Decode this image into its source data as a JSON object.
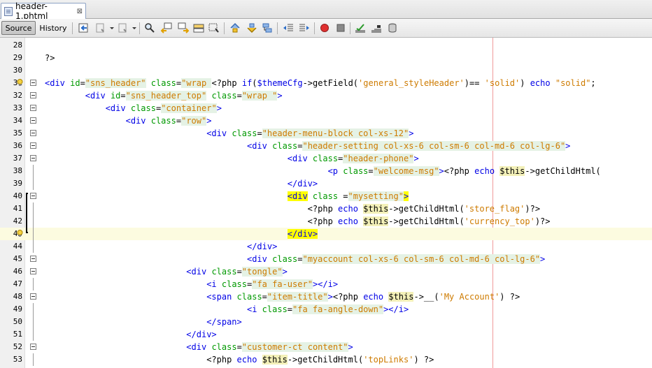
{
  "tab": {
    "title": "header-1.phtml",
    "close": "⊠"
  },
  "toolbar": {
    "source_label": "Source",
    "history_label": "History"
  },
  "editor": {
    "lines": [
      {
        "n": "28",
        "html": ""
      },
      {
        "n": "29",
        "html": "?>"
      },
      {
        "n": "30",
        "html": ""
      },
      {
        "n": "31",
        "html": "<span class=tag>&lt;div</span> <span class=attr>id</span>=<span class=strbg>\"sns_header\"</span> <span class=attr>class</span>=<span class=strbg>\"wrap </span><span>&lt;?php</span> <span class=kw>if</span>(<span class=kw>$themeCfg</span>-&gt;getField(<span class=phpstr>'general_styleHeader'</span>)== <span class=phpstr>'solid'</span>) <span class=kw>echo</span> <span class=phpstr>\"solid\"</span>;"
      },
      {
        "n": "32",
        "html": "        <span class=tag>&lt;div</span> <span class=attr>id</span>=<span class=strbg>\"sns_header_top\"</span> <span class=attr>class</span>=<span class=strbg>\"wrap \"</span><span class=tag>&gt;</span>"
      },
      {
        "n": "33",
        "html": "            <span class=tag>&lt;div</span> <span class=attr>class</span>=<span class=strbg>\"container\"</span><span class=tag>&gt;</span>"
      },
      {
        "n": "34",
        "html": "                <span class=tag>&lt;div</span> <span class=attr>class</span>=<span class=strbg>\"row\"</span><span class=tag>&gt;</span>"
      },
      {
        "n": "35",
        "html": "                                <span class=tag>&lt;div</span> <span class=attr>class</span>=<span class=strbg>\"header-menu-block col-xs-12\"</span><span class=tag>&gt;</span>"
      },
      {
        "n": "36",
        "html": "                                        <span class=tag>&lt;div</span> <span class=attr>class</span>=<span class=strbg>\"header-setting col-xs-6 col-sm-6 col-md-6 col-lg-6\"</span><span class=tag>&gt;</span>"
      },
      {
        "n": "37",
        "html": "                                                <span class=tag>&lt;div</span> <span class=attr>class</span>=<span class=strbg>\"header-phone\"</span><span class=tag>&gt;</span>"
      },
      {
        "n": "38",
        "html": "                                                        <span class=tag>&lt;p</span> <span class=attr>class</span>=<span class=strbg>\"welcome-msg\"</span><span class=tag>&gt;</span>&lt;?php <span class=kw>echo</span> <span class=var>$this</span>-&gt;getChildHtml("
      },
      {
        "n": "39",
        "html": "                                                <span class=tag>&lt;/div&gt;</span>"
      },
      {
        "n": "40",
        "html": "                                                <span class=match><span class=tag>&lt;div</span></span> <span class=attr>class</span> =<span class=strbg>\"mysetting\"</span><span class=match><span class=tag>&gt;</span></span>"
      },
      {
        "n": "41",
        "html": "                                                    &lt;?php <span class=kw>echo</span> <span class=var>$this</span>-&gt;getChildHtml(<span class=phpstr>'store_flag'</span>)?&gt;"
      },
      {
        "n": "42",
        "html": "                                                    &lt;?php <span class=kw>echo</span> <span class=var>$this</span>-&gt;getChildHtml(<span class=phpstr>'currency_top'</span>)?&gt;"
      },
      {
        "n": "43",
        "html": "                                                <span class=match><span class=tag>&lt;/div&gt;</span></span>"
      },
      {
        "n": "44",
        "html": "                                        <span class=tag>&lt;/div&gt;</span>"
      },
      {
        "n": "45",
        "html": "                                        <span class=tag>&lt;div</span> <span class=attr>class</span>=<span class=strbg>\"myaccount col-xs-6 col-sm-6 col-md-6 col-lg-6\"</span><span class=tag>&gt;</span>"
      },
      {
        "n": "46",
        "html": "                            <span class=tag>&lt;div</span> <span class=attr>class</span>=<span class=strbg>\"tongle\"</span><span class=tag>&gt;</span>"
      },
      {
        "n": "47",
        "html": "                                <span class=tag>&lt;i</span> <span class=attr>class</span>=<span class=strbg>\"fa fa-user\"</span><span class=tag>&gt;&lt;/i&gt;</span>"
      },
      {
        "n": "48",
        "html": "                                <span class=tag>&lt;span</span> <span class=attr>class</span>=<span class=strbg>\"item-title\"</span><span class=tag>&gt;</span>&lt;?php <span class=kw>echo</span> <span class=var>$this</span>-&gt;__(<span class=phpstr>'My Account'</span>) ?&gt;"
      },
      {
        "n": "49",
        "html": "                                        <span class=tag>&lt;i</span> <span class=attr>class</span>=<span class=strbg>\"fa fa-angle-down\"</span><span class=tag>&gt;&lt;/i&gt;</span>"
      },
      {
        "n": "50",
        "html": "                                <span class=tag>&lt;/span&gt;</span>"
      },
      {
        "n": "51",
        "html": "                            <span class=tag>&lt;/div&gt;</span>"
      },
      {
        "n": "52",
        "html": "                            <span class=tag>&lt;div</span> <span class=attr>class</span>=<span class=strbg>\"customer-ct content\"</span><span class=tag>&gt;</span>"
      },
      {
        "n": "53",
        "html": "                                &lt;?php <span class=kw>echo</span> <span class=var>$this</span>-&gt;getChildHtml(<span class=phpstr>'topLinks'</span>) ?&gt;"
      }
    ]
  }
}
